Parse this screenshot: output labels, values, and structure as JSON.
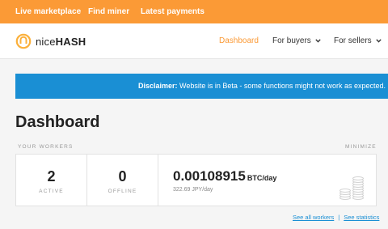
{
  "topbar": {
    "links": [
      "Live marketplace",
      "Find miner",
      "Latest payments"
    ]
  },
  "navbar": {
    "logo_light": "nice",
    "logo_bold": "HASH",
    "dashboard": "Dashboard",
    "for_buyers": "For buyers",
    "for_sellers": "For sellers"
  },
  "banner": {
    "prefix": "Disclaimer:",
    "text": " Website is in Beta - some functions might not work as expected. Pleas"
  },
  "page_title": "Dashboard",
  "workers": {
    "section_label": "YOUR WORKERS",
    "minimize": "MINIMIZE",
    "active_count": "2",
    "active_label": "ACTIVE",
    "offline_count": "0",
    "offline_label": "OFFLINE",
    "btc_value": "0.00108915",
    "btc_unit": "BTC/day",
    "jpy_value": "322.69 JPY/day"
  },
  "links": {
    "all_workers": "See all workers",
    "separator": "|",
    "statistics": "See statistics"
  },
  "colors": {
    "brand_orange": "#fb9a36",
    "banner_blue": "#1a8fd4"
  }
}
